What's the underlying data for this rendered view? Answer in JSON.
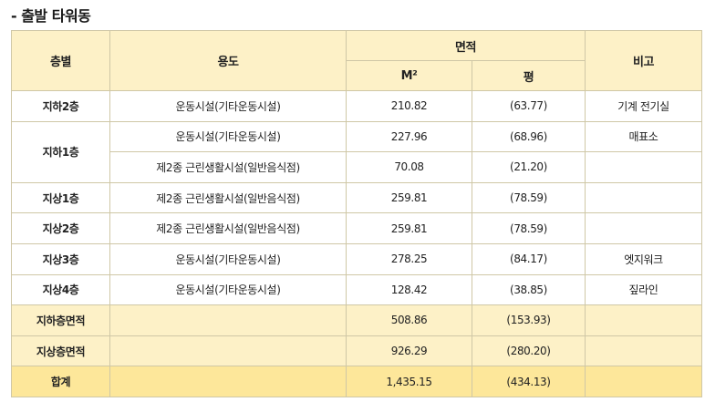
{
  "page_title": "- 출발 타워동",
  "headers": {
    "floor": "층별",
    "use": "용도",
    "area": "면적",
    "sqm": "M²",
    "pyeong": "평",
    "note": "비고"
  },
  "rows": [
    {
      "floor": "지하2층",
      "use": "운동시설(기타운동시설)",
      "sqm": "210.82",
      "pyeong": "(63.77)",
      "note": "기계  전기실"
    },
    {
      "floor": "지하1층",
      "use": "운동시설(기타운동시설)",
      "sqm": "227.96",
      "pyeong": "(68.96)",
      "note": "매표소"
    },
    {
      "floor": "",
      "use": "제2종 근린생활시설(일반음식점)",
      "sqm": "70.08",
      "pyeong": "(21.20)",
      "note": ""
    },
    {
      "floor": "지상1층",
      "use": "제2종 근린생활시설(일반음식점)",
      "sqm": "259.81",
      "pyeong": "(78.59)",
      "note": ""
    },
    {
      "floor": "지상2층",
      "use": "제2종 근린생활시설(일반음식점)",
      "sqm": "259.81",
      "pyeong": "(78.59)",
      "note": ""
    },
    {
      "floor": "지상3층",
      "use": "운동시설(기타운동시설)",
      "sqm": "278.25",
      "pyeong": "(84.17)",
      "note": "엣지워크"
    },
    {
      "floor": "지상4층",
      "use": "운동시설(기타운동시설)",
      "sqm": "128.42",
      "pyeong": "(38.85)",
      "note": "짚라인"
    }
  ],
  "subtotals": [
    {
      "label": "지하층면적",
      "sqm": "508.86",
      "pyeong": "(153.93)"
    },
    {
      "label": "지상층면적",
      "sqm": "926.29",
      "pyeong": "(280.20)"
    }
  ],
  "total": {
    "label": "합계",
    "sqm": "1,435.15",
    "pyeong": "(434.13)"
  },
  "colors": {
    "header_bg": "#fdf1c7",
    "total_bg": "#fde79a",
    "border": "#cfc7a6"
  }
}
